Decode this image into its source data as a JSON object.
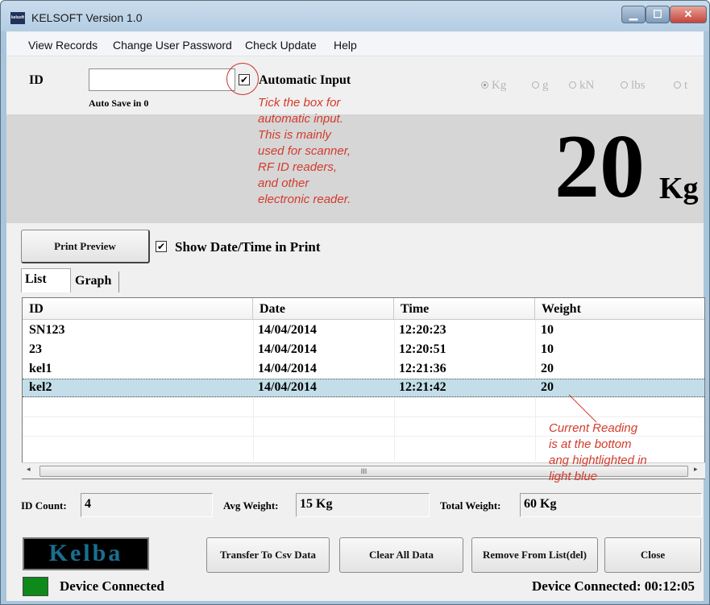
{
  "window": {
    "title": "KELSOFT Version 1.0",
    "icon_text": "kelsoft",
    "controls": [
      "minimize-icon",
      "maximize-icon",
      "close-icon"
    ]
  },
  "menu": [
    "View Records",
    "Change User Password",
    "Check Update",
    "Help"
  ],
  "id_section": {
    "id_label": "ID",
    "id_value": "",
    "auto_save": "Auto Save in 0",
    "auto_input_checked": true,
    "auto_input_label": "Automatic Input",
    "check_glyph": "✔"
  },
  "annotation_auto": [
    "Tick the box for",
    "automatic input.",
    "This is mainly",
    "used for  scanner,",
    "RF ID readers,",
    "and other",
    "electronic reader."
  ],
  "units": [
    "Kg",
    "g",
    "kN",
    "lbs",
    "t"
  ],
  "selected_unit": "Kg",
  "reading": {
    "value": "20",
    "unit": "Kg"
  },
  "print": {
    "button": "Print Preview",
    "show_datetime_checked": true,
    "show_datetime_label": "Show Date/Time in Print"
  },
  "tabs": [
    "List",
    "Graph"
  ],
  "table": {
    "columns": [
      "ID",
      "Date",
      "Time",
      "Weight"
    ],
    "rows": [
      [
        "SN123",
        "14/04/2014",
        "12:20:23",
        "10"
      ],
      [
        "23",
        "14/04/2014",
        "12:20:51",
        "10"
      ],
      [
        "kel1",
        "14/04/2014",
        "12:21:36",
        "20"
      ],
      [
        "kel2",
        "14/04/2014",
        "12:21:42",
        "20"
      ]
    ],
    "selected_row": 3,
    "scroll_grip": "III",
    "scroll_left": "◂",
    "scroll_right": "▸"
  },
  "annotation_current": [
    "Current Reading",
    "is at the bottom",
    "ang hightlighted in",
    "light blue"
  ],
  "stats": {
    "id_count_label": "ID Count:",
    "id_count": "4",
    "avg_label": "Avg Weight:",
    "avg": "15 Kg",
    "total_label": "Total Weight:",
    "total": "60 Kg"
  },
  "logo": "Kelba",
  "buttons": [
    "Transfer To Csv Data",
    "Clear All Data",
    "Remove From List(del)",
    "Close"
  ],
  "status": {
    "left": "Device Connected",
    "right": "Device Connected: 00:12:05",
    "led_color": "#0e8a1a"
  },
  "colors": {
    "annotation": "#d33b2c",
    "selected_row": "#c3dee9",
    "display_bg": "#d6d6d6"
  }
}
